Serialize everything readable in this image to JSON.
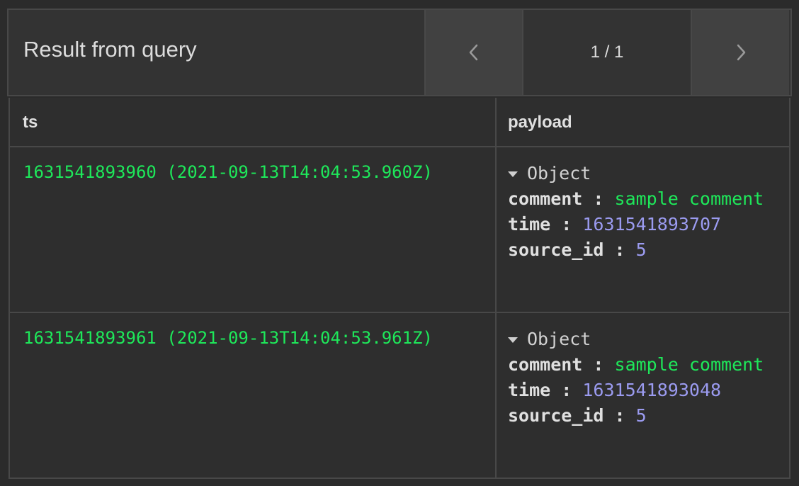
{
  "header": {
    "title": "Result from query",
    "pager": {
      "prev_icon": "chevron-left-icon",
      "next_icon": "chevron-right-icon",
      "count": "1 / 1"
    }
  },
  "table": {
    "columns": [
      "ts",
      "payload"
    ],
    "rows": [
      {
        "ts": "1631541893960 (2021-09-13T14:04:53.960Z)",
        "payload": {
          "type_label": "Object",
          "fields": [
            {
              "key": "comment",
              "sep": " : ",
              "value": "sample comment"
            },
            {
              "key": "time",
              "sep": " : ",
              "value": "1631541893707"
            },
            {
              "key": "source_id",
              "sep": " : ",
              "value": "5"
            }
          ]
        }
      },
      {
        "ts": "1631541893961 (2021-09-13T14:04:53.961Z)",
        "payload": {
          "type_label": "Object",
          "fields": [
            {
              "key": "comment",
              "sep": " : ",
              "value": "sample comment"
            },
            {
              "key": "time",
              "sep": " : ",
              "value": "1631541893048"
            },
            {
              "key": "source_id",
              "sep": " : ",
              "value": "5"
            }
          ]
        }
      }
    ]
  },
  "colors": {
    "background": "#2b2b2b",
    "string_value": "#1ee85a",
    "number_value": "#9b9bf0",
    "border": "#484848"
  }
}
